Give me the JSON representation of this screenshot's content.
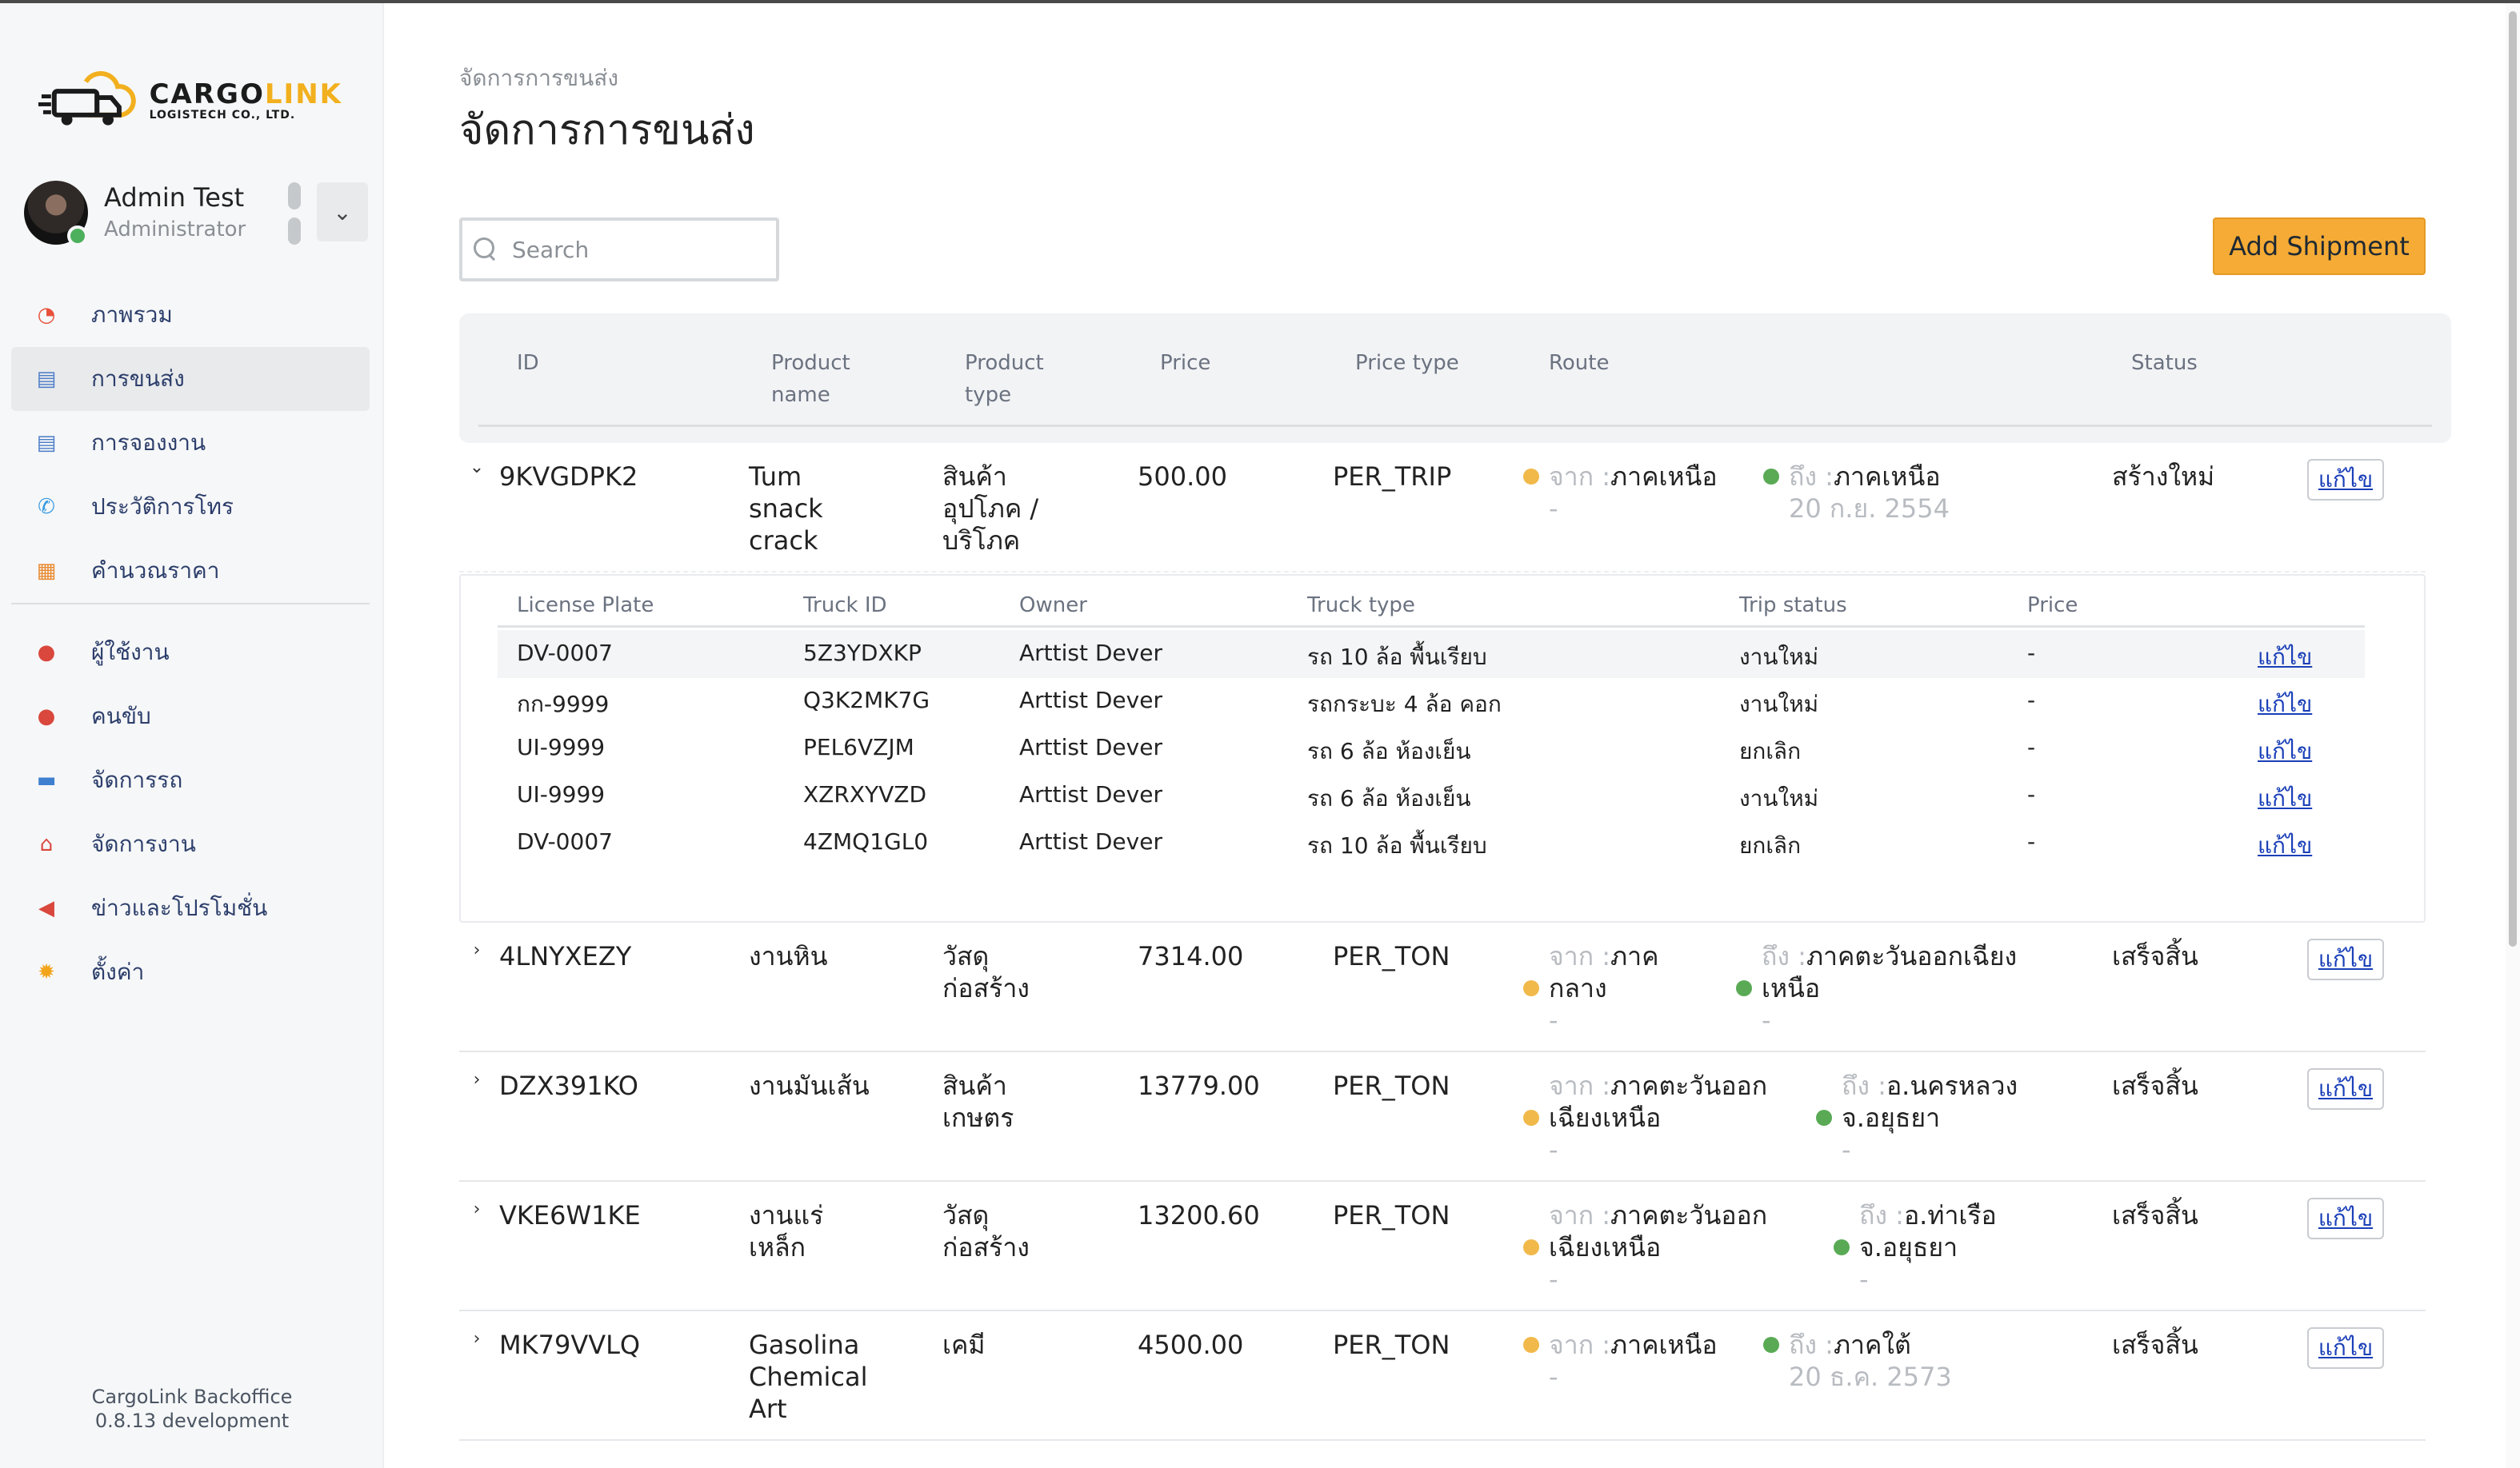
{
  "app": {
    "brand_name_a": "CARGO",
    "brand_name_b": "LINK",
    "brand_sub": "LOGISTECH CO., LTD.",
    "footer_line1": "CargoLink Backoffice",
    "footer_line2": "0.8.13 development"
  },
  "user": {
    "name": "Admin Test",
    "role": "Administrator"
  },
  "nav": [
    {
      "label": "ภาพรวม",
      "icon": "pie-chart-icon",
      "color": "#e8503a"
    },
    {
      "label": "การขนส่ง",
      "icon": "clipboard-icon",
      "color": "#4a7cc7",
      "active": true
    },
    {
      "label": "การจองงาน",
      "icon": "clipboard-icon",
      "color": "#4a7cc7"
    },
    {
      "label": "ประวัติการโทร",
      "icon": "phone-icon",
      "color": "#3b9be0"
    },
    {
      "label": "คำนวณราคา",
      "icon": "calculator-icon",
      "color": "#e8892f"
    },
    {
      "label": "ผู้ใช้งาน",
      "icon": "user-icon",
      "color": "#d9473d"
    },
    {
      "label": "คนขับ",
      "icon": "driver-icon",
      "color": "#d9473d"
    },
    {
      "label": "จัดการรถ",
      "icon": "truck-icon",
      "color": "#3e7fd0"
    },
    {
      "label": "จัดการงาน",
      "icon": "warehouse-icon",
      "color": "#d9473d"
    },
    {
      "label": "ข่าวและโปรโมชั่น",
      "icon": "megaphone-icon",
      "color": "#d9473d"
    },
    {
      "label": "ตั้งค่า",
      "icon": "gear-icon",
      "color": "#f2a51b"
    }
  ],
  "page": {
    "breadcrumb": "จัดการการขนส่ง",
    "title": "จัดการการขนส่ง",
    "search_placeholder": "Search",
    "add_button": "Add Shipment"
  },
  "table": {
    "headers": {
      "id": "ID",
      "product_name_1": "Product",
      "product_name_2": "name",
      "product_type_1": "Product",
      "product_type_2": "type",
      "price": "Price",
      "price_type": "Price type",
      "route": "Route",
      "status": "Status"
    },
    "from_label": "จาก :",
    "to_label": "ถึง :",
    "edit_label": "แก้ไข",
    "rows": [
      {
        "caret": "⌄",
        "id": "9KVGDPK2",
        "product_name": [
          "Tum",
          "snack",
          "crack"
        ],
        "product_type": [
          "สินค้า",
          "อุปโภค /",
          "บริโภค"
        ],
        "price": "500.00",
        "price_type": "PER_TRIP",
        "from": [
          "ภาคเหนือ"
        ],
        "from_sub": "-",
        "to": [
          "ภาคเหนือ"
        ],
        "to_sub": "20 ก.ย. 2554",
        "status": "สร้างใหม่"
      },
      {
        "caret": "›",
        "id": "4LNYXEZY",
        "product_name": [
          "งานหิน"
        ],
        "product_type": [
          "วัสดุ",
          "ก่อสร้าง"
        ],
        "price": "7314.00",
        "price_type": "PER_TON",
        "from": [
          "ภาค",
          "กลาง"
        ],
        "from_sub": "-",
        "to": [
          "ภาคตะวันออกเฉียง",
          "เหนือ"
        ],
        "to_sub": "-",
        "status": "เสร็จสิ้น"
      },
      {
        "caret": "›",
        "id": "DZX391KO",
        "product_name": [
          "งานมันเส้น"
        ],
        "product_type": [
          "สินค้า",
          "เกษตร"
        ],
        "price": "13779.00",
        "price_type": "PER_TON",
        "from": [
          "ภาคตะวันออก",
          "เฉียงเหนือ"
        ],
        "from_sub": "-",
        "to": [
          "อ.นครหลวง",
          "จ.อยุธยา"
        ],
        "to_sub": "-",
        "status": "เสร็จสิ้น"
      },
      {
        "caret": "›",
        "id": "VKE6W1KE",
        "product_name": [
          "งานแร่",
          "เหล็ก"
        ],
        "product_type": [
          "วัสดุ",
          "ก่อสร้าง"
        ],
        "price": "13200.60",
        "price_type": "PER_TON",
        "from": [
          "ภาคตะวันออก",
          "เฉียงเหนือ"
        ],
        "from_sub": "-",
        "to": [
          "อ.ท่าเรือ",
          "จ.อยุธยา"
        ],
        "to_sub": "-",
        "status": "เสร็จสิ้น"
      },
      {
        "caret": "›",
        "id": "MK79VVLQ",
        "product_name": [
          "Gasolina",
          "Chemical",
          "Art"
        ],
        "product_type": [
          "เคมี"
        ],
        "price": "4500.00",
        "price_type": "PER_TON",
        "from": [
          "ภาคเหนือ"
        ],
        "from_sub": "-",
        "to": [
          "ภาคใต้"
        ],
        "to_sub": "20 ธ.ค. 2573",
        "status": "เสร็จสิ้น"
      }
    ]
  },
  "trips": {
    "headers": {
      "license_plate": "License Plate",
      "truck_id": "Truck ID",
      "owner": "Owner",
      "truck_type": "Truck type",
      "trip_status": "Trip status",
      "price": "Price"
    },
    "rows": [
      {
        "plate": "DV-0007",
        "truck_id": "5Z3YDXKP",
        "owner": "Arttist Dever",
        "truck_type": "รถ 10 ล้อ พื้นเรียบ",
        "status": "งานใหม่",
        "price": "-"
      },
      {
        "plate": "กก-9999",
        "truck_id": "Q3K2MK7G",
        "owner": "Arttist Dever",
        "truck_type": "รถกระบะ 4 ล้อ คอก",
        "status": "งานใหม่",
        "price": "-"
      },
      {
        "plate": "UI-9999",
        "truck_id": "PEL6VZJM",
        "owner": "Arttist Dever",
        "truck_type": "รถ 6 ล้อ ห้องเย็น",
        "status": "ยกเลิก",
        "price": "-"
      },
      {
        "plate": "UI-9999",
        "truck_id": "XZRXYVZD",
        "owner": "Arttist Dever",
        "truck_type": "รถ 6 ล้อ ห้องเย็น",
        "status": "งานใหม่",
        "price": "-"
      },
      {
        "plate": "DV-0007",
        "truck_id": "4ZMQ1GL0",
        "owner": "Arttist Dever",
        "truck_type": "รถ 10 ล้อ พื้นเรียบ",
        "status": "ยกเลิก",
        "price": "-"
      }
    ]
  },
  "colors": {
    "accent": "#f5ab35",
    "link": "#1a3fb8",
    "route_from_dot": "#f1b94a",
    "route_to_dot": "#5aaa55"
  }
}
